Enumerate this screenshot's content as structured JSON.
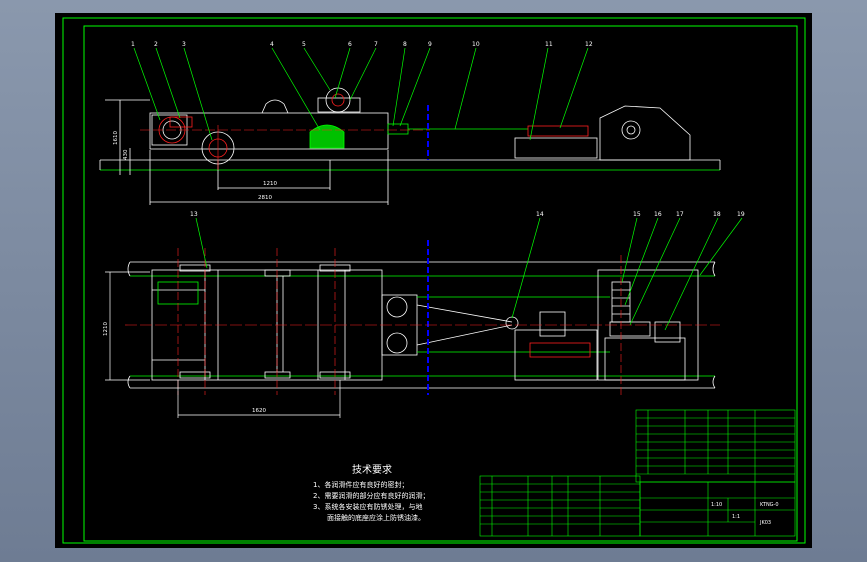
{
  "drawing": {
    "tech_requirements": {
      "title": "技术要求",
      "lines": [
        "1、各润滑件应有良好的密封；",
        "2、需要润滑的部分应有良好的润滑；",
        "3、系统各安装应有防锈处理，与地",
        "面接触的底座应涂上防锈油漆。"
      ]
    },
    "dimensions": {
      "front_width_inner": "1210",
      "front_width_outer": "2810",
      "front_height_total": "1610",
      "front_height_partial": "430",
      "plan_height": "1210",
      "plan_width": "1620"
    },
    "front_view_balloons": [
      "1",
      "2",
      "3",
      "4",
      "5",
      "6",
      "7",
      "8",
      "9",
      "10",
      "11",
      "12"
    ],
    "plan_view_balloons": [
      "13",
      "14",
      "15",
      "16",
      "17",
      "18",
      "19"
    ],
    "title_block": {
      "scale": "1:10",
      "sheet": "1:1",
      "drawing_no": "KTNG-0",
      "name_code": "JK03"
    },
    "colors": {
      "background": "#000000",
      "frame": "#00ff00",
      "outline": "#ffffff",
      "centerline": "#ff2020",
      "highlight": "#0000ff",
      "leader": "#00ff00"
    }
  }
}
